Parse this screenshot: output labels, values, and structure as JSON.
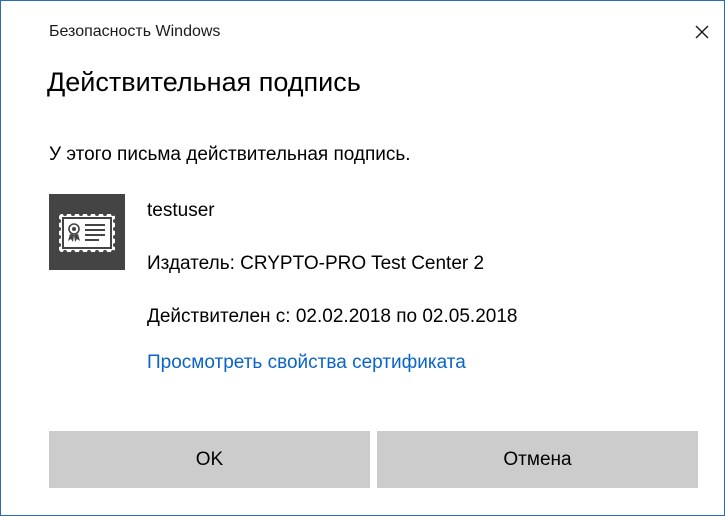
{
  "window": {
    "title": "Безопасность Windows",
    "close_icon": "close-icon"
  },
  "heading": "Действительная подпись",
  "message": "У этого письма действительная подпись.",
  "certificate": {
    "icon": "certificate-icon",
    "name": "testuser",
    "issuer": "Издатель: CRYPTO-PRO Test Center 2",
    "validity": "Действителен с: 02.02.2018 по 02.05.2018",
    "view_link": "Просмотреть свойства сертификата"
  },
  "buttons": {
    "ok": "OK",
    "cancel": "Отмена"
  },
  "colors": {
    "border": "#2b6cb0",
    "link": "#0a64c8",
    "button_bg": "#cccccc",
    "icon_bg": "#444444"
  }
}
